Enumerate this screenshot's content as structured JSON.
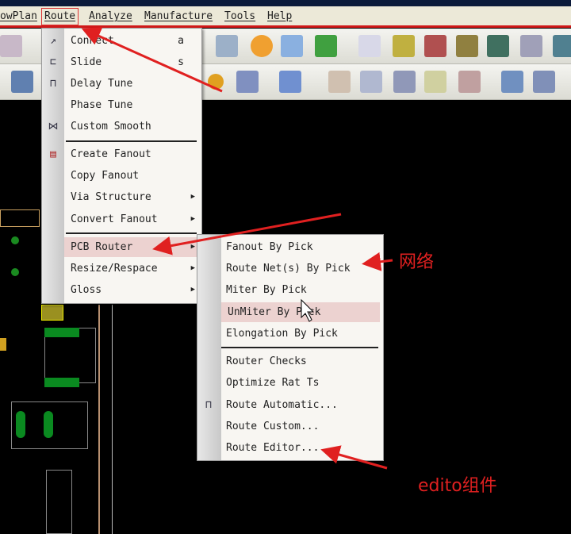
{
  "menubar": {
    "items": [
      "owPlan",
      "Route",
      "Analyze",
      "Manufacture",
      "Tools",
      "Help"
    ]
  },
  "route_menu": {
    "items": [
      {
        "label": "Connect",
        "shortcut": "a",
        "icon": "connect-icon"
      },
      {
        "label": "Slide",
        "shortcut": "s",
        "icon": "slide-icon"
      },
      {
        "label": "Delay Tune",
        "icon": "delay-tune-icon"
      },
      {
        "label": "Phase Tune"
      },
      {
        "label": "Custom Smooth",
        "icon": "custom-smooth-icon"
      },
      {
        "label": "Create Fanout",
        "icon": "fanout-icon"
      },
      {
        "label": "Copy Fanout"
      },
      {
        "label": "Via Structure",
        "submenu": true
      },
      {
        "label": "Convert Fanout",
        "submenu": true
      },
      {
        "label": "PCB Router",
        "submenu": true,
        "highlighted": true
      },
      {
        "label": "Resize/Respace",
        "submenu": true
      },
      {
        "label": "Gloss",
        "submenu": true
      }
    ]
  },
  "pcb_router_submenu": {
    "items": [
      {
        "label": "Fanout By Pick"
      },
      {
        "label": "Route Net(s) By Pick"
      },
      {
        "label": "Miter By Pick"
      },
      {
        "label": "UnMiter By Pick",
        "highlighted": true
      },
      {
        "label": "Elongation By Pick"
      },
      {
        "label": "Router Checks"
      },
      {
        "label": "Optimize Rat Ts"
      },
      {
        "label": "Route Automatic...",
        "icon": "route-automatic-icon"
      },
      {
        "label": "Route Custom..."
      },
      {
        "label": "Route Editor..."
      }
    ]
  },
  "annotations": {
    "net": "网络",
    "editor": "edito组件"
  },
  "colors": {
    "annotation": "#e02020",
    "highlight": "#ecd2d0",
    "menubar_line": "#d01818"
  }
}
